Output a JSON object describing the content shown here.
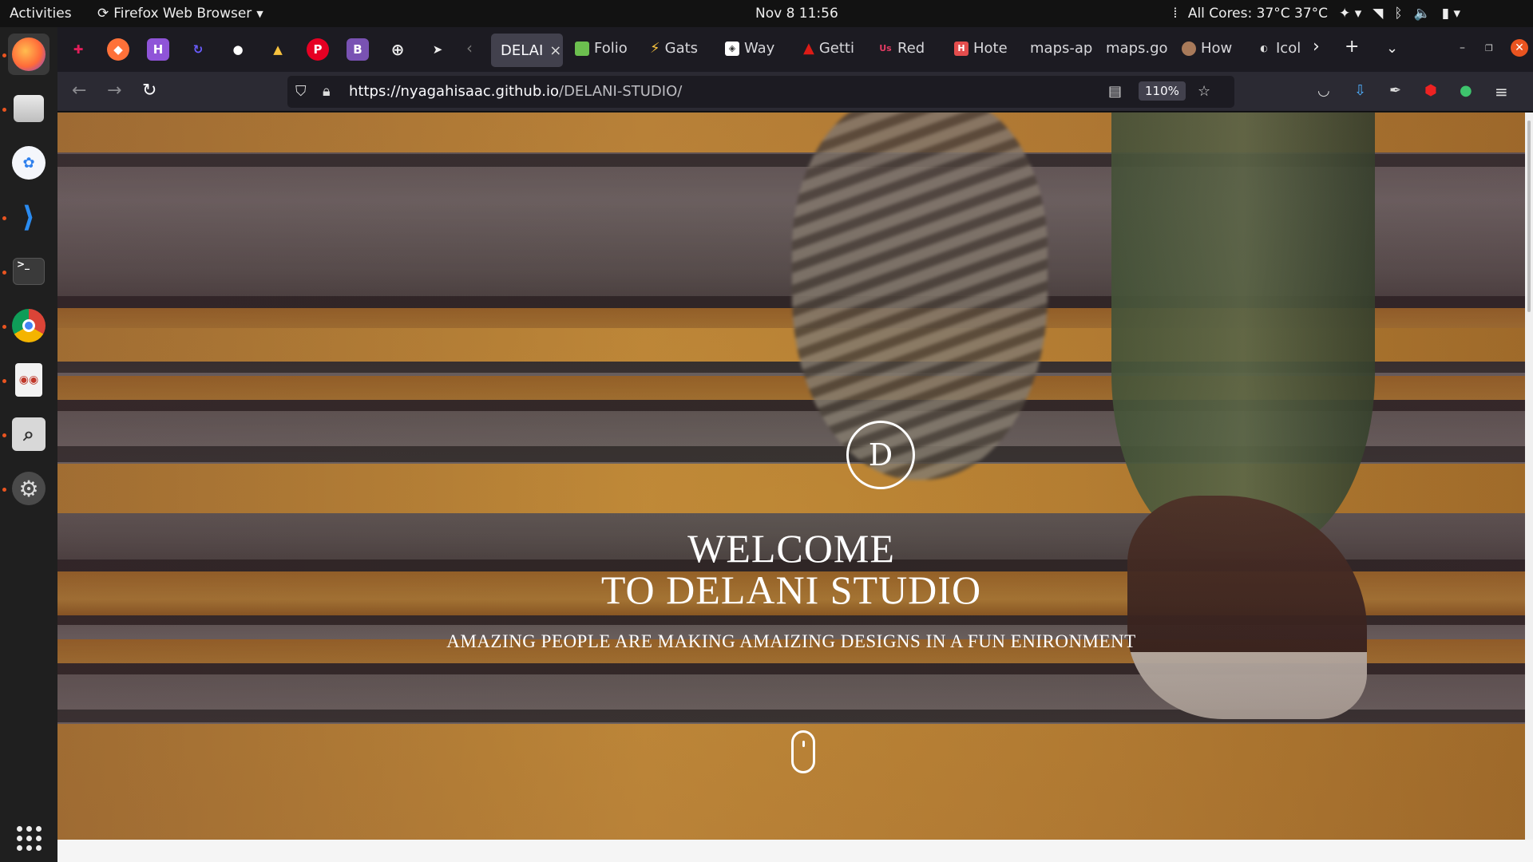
{
  "topbar": {
    "activities": "Activities",
    "app_name": "Firefox Web Browser",
    "clock": "Nov 8  11:56",
    "cpu": "All Cores: 37°C 37°C"
  },
  "dock": {
    "items": [
      "firefox",
      "files",
      "vscodium",
      "vscode",
      "terminal",
      "chrome",
      "document-viewer",
      "screenshot",
      "settings",
      "show-apps"
    ]
  },
  "tabs": {
    "active": {
      "label": "DELAI"
    },
    "others": [
      {
        "label": "Folio",
        "fav": "folio-icon",
        "color": "#6cbf4f"
      },
      {
        "label": "Gats",
        "fav": "bolt-icon",
        "color": "#f7c23e"
      },
      {
        "label": "Way",
        "fav": "wayback-icon",
        "color": "#ffffff"
      },
      {
        "label": "Getti",
        "fav": "angular-icon",
        "color": "#dd1b16"
      },
      {
        "label": "Red",
        "fav": "us-icon",
        "color": "#e23b63"
      },
      {
        "label": "Hote",
        "fav": "hotel-icon",
        "color": "#e44d4d"
      },
      {
        "label": "maps-ap",
        "fav": "",
        "color": ""
      },
      {
        "label": "maps.go",
        "fav": "",
        "color": ""
      },
      {
        "label": "How",
        "fav": "avatar-icon",
        "color": "#a87a5a"
      },
      {
        "label": "Icol",
        "fav": "ico-icon",
        "color": "#dddddd"
      }
    ]
  },
  "navbar": {
    "url_host": "https://nyagahisaac.github.io",
    "url_path": "/DELANI-STUDIO/",
    "zoom": "110%"
  },
  "hero": {
    "logo_letter": "D",
    "headline_line1": "WELCOME",
    "headline_line2": "TO DELANI STUDIO",
    "subline": "AMAZING PEOPLE ARE MAKING AMAIZING DESIGNS IN A FUN ENIRONMENT"
  },
  "colors": {
    "accent": "#e95420",
    "tab_active": "#42414d",
    "urlbar": "#1c1b22"
  }
}
